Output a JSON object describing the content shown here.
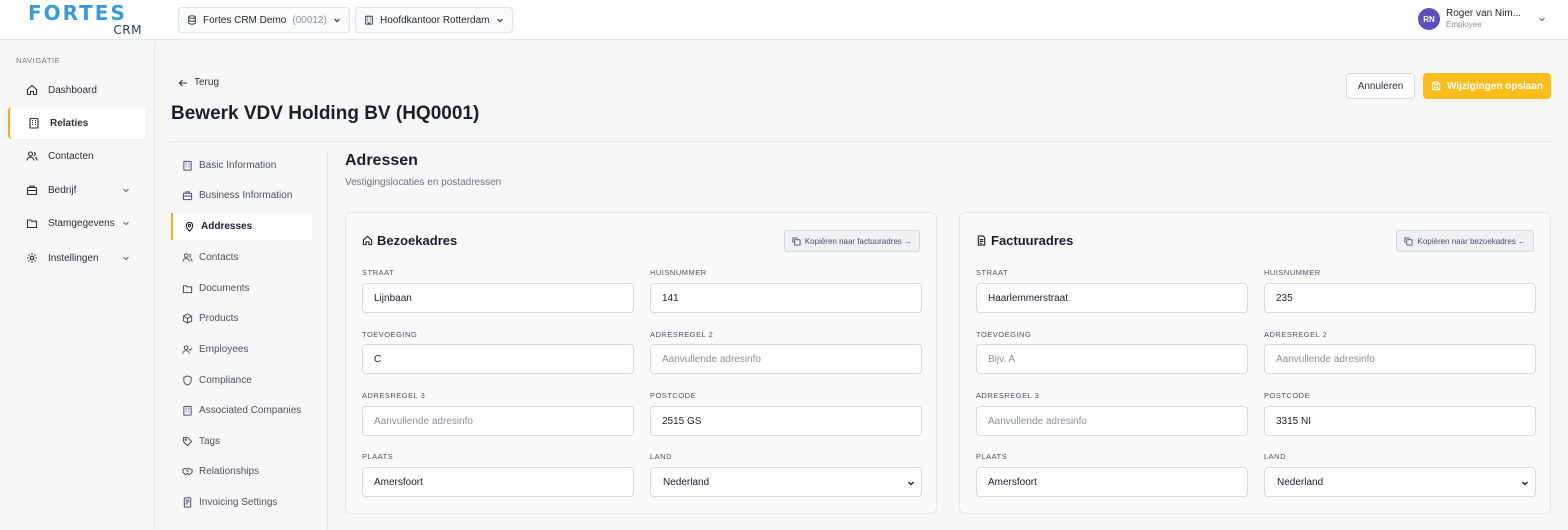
{
  "header": {
    "logo_main": "FORTES",
    "logo_sub": "CRM",
    "org_select": {
      "label": "Fortes CRM Demo",
      "code": "(00012)"
    },
    "office_select": {
      "label": "Hoofdkantoor Rotterdam"
    },
    "user": {
      "initials": "RN",
      "name": "Roger van Nim...",
      "role": "Employee"
    }
  },
  "sidebar": {
    "section_label": "NAVIGATIE",
    "items": [
      {
        "label": "Dashboard",
        "icon": "home-icon"
      },
      {
        "label": "Relaties",
        "icon": "building-icon",
        "active": true
      },
      {
        "label": "Contacten",
        "icon": "users-icon"
      },
      {
        "label": "Bedrijf",
        "icon": "briefcase-icon",
        "expandable": true
      },
      {
        "label": "Stamgegevens",
        "icon": "folder-icon",
        "expandable": true
      },
      {
        "label": "Instellingen",
        "icon": "gear-icon",
        "expandable": true
      }
    ]
  },
  "page": {
    "back_label": "Terug",
    "title": "Bewerk VDV Holding BV (HQ0001)",
    "cancel_label": "Annuleren",
    "save_label": "Wijzigingen opslaan"
  },
  "subnav": {
    "items": [
      {
        "label": "Basic Information",
        "icon": "building-icon"
      },
      {
        "label": "Business Information",
        "icon": "briefcase-icon"
      },
      {
        "label": "Addresses",
        "icon": "map-pin-icon",
        "active": true
      },
      {
        "label": "Contacts",
        "icon": "users-icon"
      },
      {
        "label": "Documents",
        "icon": "folder-icon"
      },
      {
        "label": "Products",
        "icon": "package-icon"
      },
      {
        "label": "Employees",
        "icon": "user-check-icon"
      },
      {
        "label": "Compliance",
        "icon": "shield-icon"
      },
      {
        "label": "Associated Companies",
        "icon": "building-icon"
      },
      {
        "label": "Tags",
        "icon": "tag-icon"
      },
      {
        "label": "Relationships",
        "icon": "handshake-icon"
      },
      {
        "label": "Invoicing Settings",
        "icon": "receipt-icon"
      }
    ]
  },
  "section": {
    "title": "Adressen",
    "subtitle": "Vestigingslocaties en postadressen"
  },
  "visit": {
    "title": "Bezoekadres",
    "copy_label": "Kopiëren naar factuuradres →",
    "labels": {
      "straat": "STRAAT",
      "huisnummer": "HUISNUMMER",
      "toevoeging": "TOEVOEGING",
      "adresregel2": "ADRESREGEL 2",
      "adresregel3": "ADRESREGEL 3",
      "postcode": "POSTCODE",
      "plaats": "PLAATS",
      "land": "LAND"
    },
    "values": {
      "straat": "Lijnbaan",
      "huisnummer": "141",
      "toevoeging": "C",
      "adresregel2": "",
      "adresregel3": "",
      "postcode": "2515 GS",
      "plaats": "Amersfoort",
      "land": "Nederland"
    },
    "placeholders": {
      "toevoeging": "Bijv. A",
      "adresregel2": "Aanvullende adresinfo",
      "adresregel3": "Aanvullende adresinfo"
    }
  },
  "invoice": {
    "title": "Factuuradres",
    "copy_label": "Kopiëren naar bezoekadres ←",
    "labels": {
      "straat": "STRAAT",
      "huisnummer": "HUISNUMMER",
      "toevoeging": "TOEVOEGING",
      "adresregel2": "ADRESREGEL 2",
      "adresregel3": "ADRESREGEL 3",
      "postcode": "POSTCODE",
      "plaats": "PLAATS",
      "land": "LAND"
    },
    "values": {
      "straat": "Haarlemmerstraat",
      "huisnummer": "235",
      "toevoeging": "",
      "adresregel2": "",
      "adresregel3": "",
      "postcode": "3315 NI",
      "plaats": "Amersfoort",
      "land": "Nederland"
    },
    "placeholders": {
      "toevoeging": "Bijv. A",
      "adresregel2": "Aanvullende adresinfo",
      "adresregel3": "Aanvullende adresinfo"
    }
  },
  "colors": {
    "accent": "#fbbd1b",
    "brand": "#3a9bd9",
    "active_border": "#f5a623",
    "avatar": "#5a4fbd"
  }
}
